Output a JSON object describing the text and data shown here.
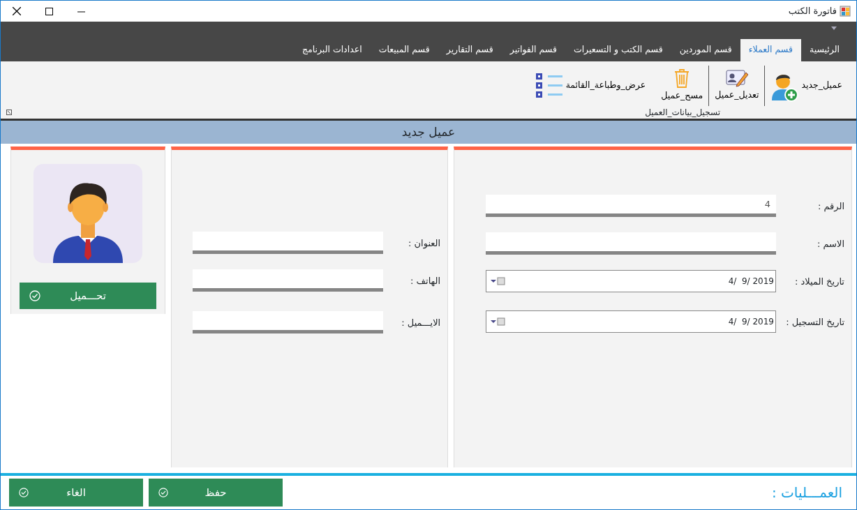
{
  "window": {
    "title": "فاتورة الكتب"
  },
  "tabs": [
    {
      "label": "الرئيسية",
      "selected": false
    },
    {
      "label": "قسم العملاء",
      "selected": true
    },
    {
      "label": "قسم الموردين",
      "selected": false
    },
    {
      "label": "قسم الكتب و التسعيرات",
      "selected": false
    },
    {
      "label": "قسم الفواتير",
      "selected": false
    },
    {
      "label": "قسم التقارير",
      "selected": false
    },
    {
      "label": "قسم المبيعات",
      "selected": false
    },
    {
      "label": "اعدادات البرنامج",
      "selected": false
    }
  ],
  "ribbon_group": {
    "label": "تسجيل_بيانات_العميل",
    "buttons": [
      {
        "label": "عميل_جديد",
        "kind": "add-person"
      },
      {
        "label": "تعديل_عميل",
        "kind": "edit"
      },
      {
        "label": "مسح_عميل",
        "kind": "delete"
      },
      {
        "label": "عرض_وطباعة_القائمة",
        "kind": "list"
      }
    ]
  },
  "form_header": "عميل جديد",
  "main_fields": [
    {
      "label": "الرقم :",
      "kind": "text",
      "value": "4"
    },
    {
      "label": "الاسم :",
      "kind": "text"
    },
    {
      "label": "تاريخ الميلاد :",
      "kind": "date",
      "value": "4/  9/ 2019"
    },
    {
      "label": "تاريخ التسجيل :",
      "kind": "date",
      "value": "4/  9/ 2019"
    }
  ],
  "contact_fields": [
    {
      "label": "العنوان :",
      "kind": "text"
    },
    {
      "label": "الهاتف :",
      "kind": "text"
    },
    {
      "label": "الايـــميل :",
      "kind": "text"
    }
  ],
  "photo": {
    "button": "تحـــميل"
  },
  "footer": {
    "label": "العمـــليات :",
    "buttons": [
      "حفظ",
      "الغاء"
    ]
  }
}
